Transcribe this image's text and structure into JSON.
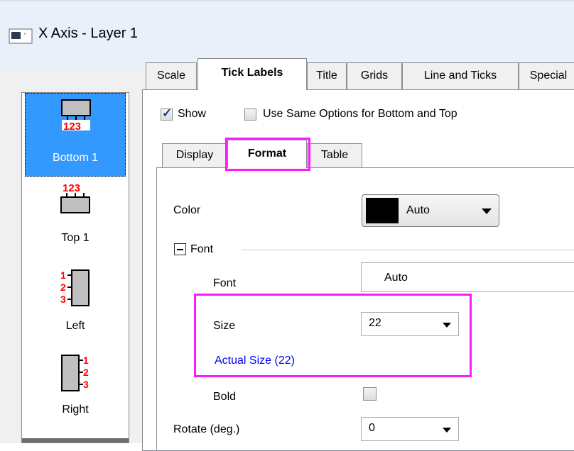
{
  "window": {
    "title": "X Axis - Layer 1"
  },
  "sidebar": {
    "items": [
      {
        "label": "Bottom 1",
        "selected": true,
        "icon": "axis-bottom-icon",
        "numbers": "123"
      },
      {
        "label": "Top 1",
        "selected": false,
        "icon": "axis-top-icon",
        "numbers": "123"
      },
      {
        "label": "Left",
        "selected": false,
        "icon": "axis-left-icon",
        "numbers": "123"
      },
      {
        "label": "Right",
        "selected": false,
        "icon": "axis-right-icon",
        "numbers": "123"
      }
    ]
  },
  "tabs": [
    {
      "label": "Scale",
      "active": false
    },
    {
      "label": "Tick Labels",
      "active": true
    },
    {
      "label": "Title",
      "active": false
    },
    {
      "label": "Grids",
      "active": false
    },
    {
      "label": "Line and Ticks",
      "active": false
    },
    {
      "label": "Special",
      "active": false
    }
  ],
  "options": {
    "show_label": "Show",
    "show_checked": true,
    "same_options_label": "Use Same Options for Bottom and Top",
    "same_options_checked": false
  },
  "subtabs": [
    {
      "label": "Display",
      "active": false
    },
    {
      "label": "Format",
      "active": true
    },
    {
      "label": "Table",
      "active": false
    }
  ],
  "format": {
    "color_label": "Color",
    "color_value": "Auto",
    "color_swatch": "#000000",
    "font_group_label": "Font",
    "font_label": "Font",
    "font_value": "Auto",
    "size_label": "Size",
    "size_value": "22",
    "actual_size_label": "Actual Size (22)",
    "bold_label": "Bold",
    "bold_checked": false,
    "rotate_label": "Rotate (deg.)",
    "rotate_value": "0"
  },
  "colors": {
    "highlight": "#ff19ff",
    "selection": "#3399ff",
    "link_text": "#0000ee",
    "axis_numbers": "#ff0000"
  }
}
